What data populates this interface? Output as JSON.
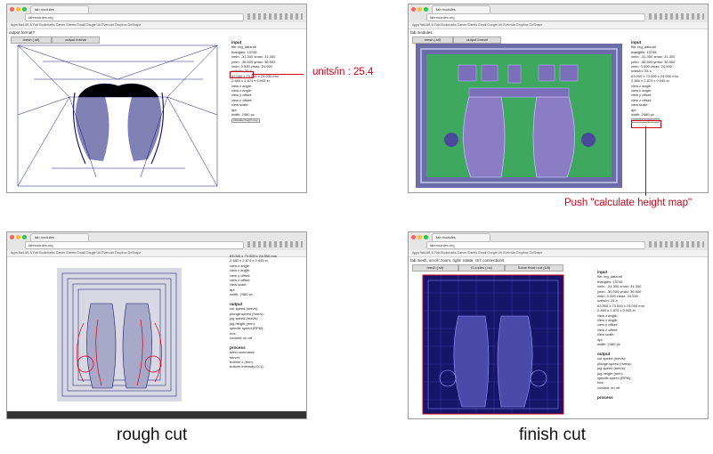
{
  "callouts": {
    "units": "units/in : 25.4",
    "calc": "Push \"calculate height map\""
  },
  "captions": {
    "rough": "rough cut",
    "finish": "finish cut"
  },
  "browser": {
    "tab_title": "fab modules",
    "url": "fabmodules.org",
    "bookmarks": "Apps  fabLAB 3/ Fab  Bookmarks  Carver  Sheets  Gmail  Google UK  Evernote  Dropbox  OnShape"
  },
  "screens": {
    "s1": {
      "appbar": "output format?",
      "tabs": [
        "mesh (.stl)",
        "output format"
      ],
      "panel": [
        "input",
        "file: leg_data.stl",
        "triangles: 13748",
        "xmin: -31.300 xmax: 31.300",
        "ymin: -36.500 ymax: 36.500",
        "zmin: 0.000 zmax: 24.000",
        "units/in: 25.4",
        "63.000 x 73.000 x 24.000 mm",
        "2.480 x 2.874 x 0.945 in",
        "view z angle:",
        "view x angle:",
        "view y offset:",
        "view z offset:",
        "view scale:",
        "dpi:",
        "width: 2480 px",
        "calculate height map"
      ]
    },
    "s2": {
      "appbar": "fab modules",
      "tabs": [
        "mesh (.stl)",
        "output format"
      ],
      "panel": [
        "input",
        "file: leg_data.stl",
        "triangles: 13748",
        "xmin: -31.300 xmax: 31.300",
        "ymin: -36.500 ymax: 36.500",
        "zmin: 0.000 zmax: 24.000",
        "units/in: 25.4",
        "63.000 x 73.000 x 24.000 mm",
        "2.480 x 2.874 x 0.945 in",
        "view z angle:",
        "view x angle:",
        "view y offset:",
        "view z offset:",
        "view scale:",
        "dpi:",
        "width: 2480 px",
        "calculate height map"
      ]
    },
    "s3": {
      "panel": [
        "63.000 x 73.000 x 24.000 mm",
        "2.480 x 2.874 x 0.945 in",
        "view z angle:",
        "view x angle:",
        "view y offset:",
        "view z offset:",
        "view scale:",
        "dpi:",
        "width: 2480 px",
        "",
        "output",
        "cut speed (mm/s):",
        "plunge speed (mm/s):",
        "jog speed (mm/s):",
        "jog height (mm):",
        "spindle speed (RPM):",
        "tool:",
        "coolant: on  off",
        "",
        "process",
        "send command:",
        "server:",
        "bottom z (mm):",
        "bottom intensity (0-1):"
      ]
    },
    "s4": {
      "appbar": "fab  mesh, scroll: zoom, right: rotate, ctrl: connections",
      "tabs": [
        "mesh (.stl)",
        "G-codes (.nc)",
        "Some finish cut (1/8)"
      ],
      "panel": [
        "input",
        "file: leg_data.stl",
        "triangles: 13748",
        "xmin: -31.300 xmax: 31.300",
        "ymin: -36.500 ymax: 36.500",
        "zmin: 0.000 zmax: 24.000",
        "units/in: 25.4",
        "63.000 x 73.000 x 24.000 mm",
        "2.480 x 2.874 x 0.945 in",
        "view z angle:",
        "view x angle:",
        "view y offset:",
        "view z offset:",
        "view scale:",
        "dpi:",
        "width: 2480 px",
        "",
        "output",
        "cut speed (mm/s):",
        "plunge speed (mm/s):",
        "jog speed (mm/s):",
        "jog height (mm):",
        "spindle speed (RPM):",
        "tool:",
        "coolant: on  off",
        "",
        "process"
      ]
    }
  },
  "colors": {
    "red": "#d4001a",
    "heightmap_bg": "#3ea85f",
    "heightmap_border": "#6c6ca8",
    "mesh_blue": "#1a1a7a",
    "finish_fill": "#15156a"
  }
}
